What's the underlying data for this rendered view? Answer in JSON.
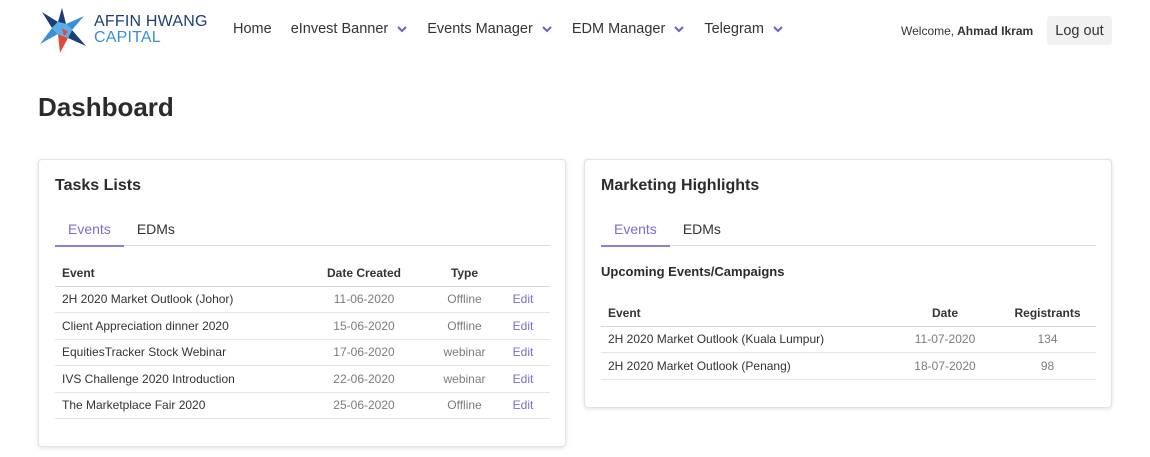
{
  "brand": {
    "line1": "AFFIN HWANG",
    "line2": "CAPITAL"
  },
  "nav": {
    "items": [
      {
        "label": "Home",
        "dropdown": false
      },
      {
        "label": "eInvest Banner",
        "dropdown": true
      },
      {
        "label": "Events Manager",
        "dropdown": true
      },
      {
        "label": "EDM Manager",
        "dropdown": true
      },
      {
        "label": "Telegram",
        "dropdown": true
      }
    ]
  },
  "user": {
    "welcome": "Welcome,",
    "name": "Ahmad Ikram",
    "logout_label": "Log out"
  },
  "page": {
    "title": "Dashboard"
  },
  "tasks": {
    "title": "Tasks Lists",
    "tabs": [
      {
        "label": "Events",
        "active": true
      },
      {
        "label": "EDMs",
        "active": false
      }
    ],
    "columns": [
      "Event",
      "Date Created",
      "Type",
      ""
    ],
    "rows": [
      {
        "event": "2H 2020 Market Outlook (Johor)",
        "date": "11-06-2020",
        "type": "Offline",
        "action": "Edit"
      },
      {
        "event": "Client Appreciation dinner 2020",
        "date": "15-06-2020",
        "type": "Offline",
        "action": "Edit"
      },
      {
        "event": "EquitiesTracker Stock Webinar",
        "date": "17-06-2020",
        "type": "webinar",
        "action": "Edit"
      },
      {
        "event": "IVS Challenge 2020 Introduction",
        "date": "22-06-2020",
        "type": "webinar",
        "action": "Edit"
      },
      {
        "event": "The Marketplace Fair 2020",
        "date": "25-06-2020",
        "type": "Offline",
        "action": "Edit"
      }
    ]
  },
  "highlights": {
    "title": "Marketing Highlights",
    "tabs": [
      {
        "label": "Events",
        "active": true
      },
      {
        "label": "EDMs",
        "active": false
      }
    ],
    "section_title": "Upcoming Events/Campaigns",
    "columns": [
      "Event",
      "Date",
      "Registrants"
    ],
    "rows": [
      {
        "event": "2H 2020 Market Outlook (Kuala Lumpur)",
        "date": "11-07-2020",
        "registrants": "134"
      },
      {
        "event": "2H 2020 Market Outlook (Penang)",
        "date": "18-07-2020",
        "registrants": "98"
      }
    ]
  },
  "colors": {
    "accent": "#7b6dd1",
    "logo_navy": "#1d3d7a",
    "logo_blue": "#3a8fd6",
    "logo_red": "#e04a3a"
  }
}
